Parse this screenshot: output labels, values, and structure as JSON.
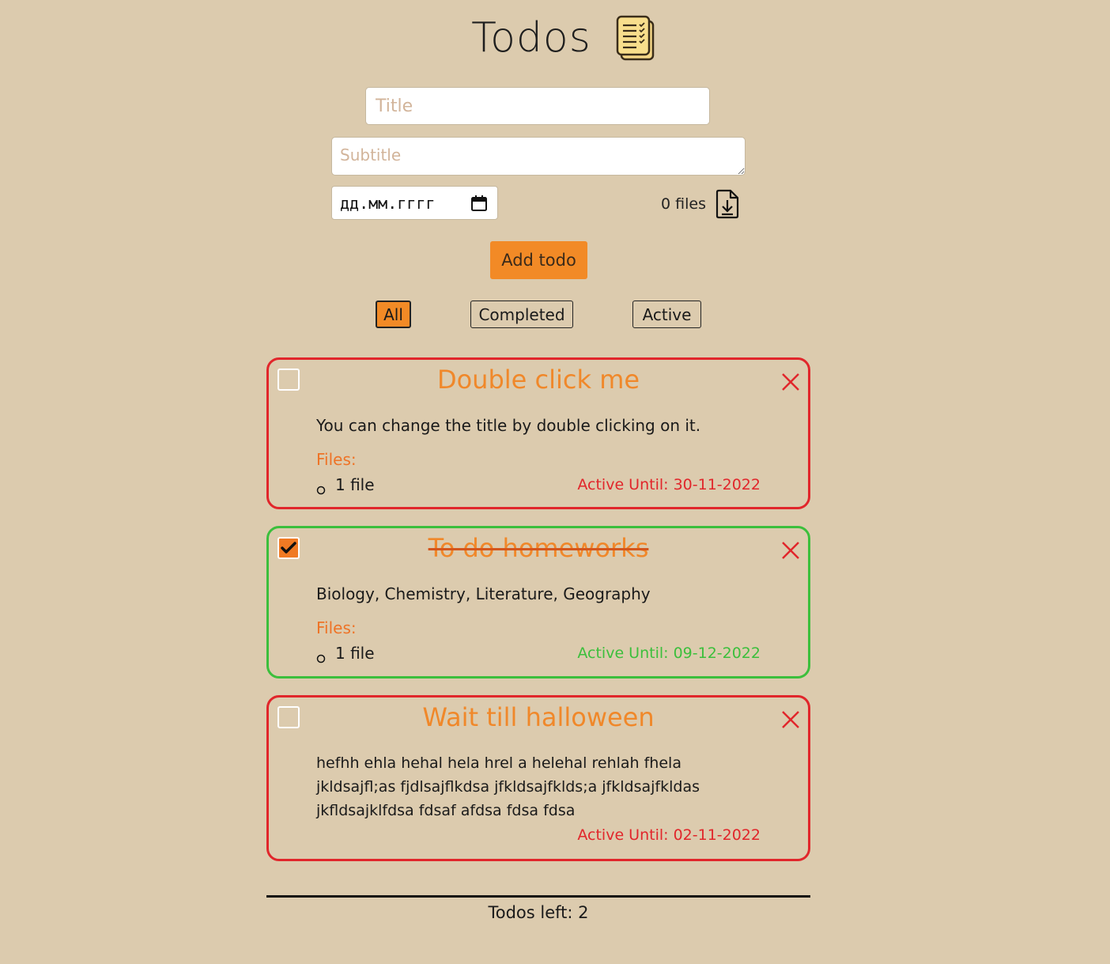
{
  "header": {
    "title": "Todos",
    "logo_icon": "notes-icon"
  },
  "form": {
    "title_placeholder": "Title",
    "subtitle_placeholder": "Subtitle",
    "date_placeholder": "дд.мм.гггг",
    "files_count_label": "0 files",
    "add_button_label": "Add todo"
  },
  "filters": {
    "all": "All",
    "completed": "Completed",
    "active": "Active",
    "selected": "All"
  },
  "todos": [
    {
      "title": "Double click me",
      "description": "You can change the title by double clicking on it.",
      "files_label": "Files:",
      "files": [
        "1 file"
      ],
      "active_until": "Active Until: 30-11-2022",
      "completed": false
    },
    {
      "title": "To do homeworks",
      "description": "Biology, Chemistry, Literature, Geography",
      "files_label": "Files:",
      "files": [
        "1 file"
      ],
      "active_until": "Active Until: 09-12-2022",
      "completed": true
    },
    {
      "title": "Wait till halloween",
      "description_lines": [
        "hefhh ehla hehal hela hrel a helehal rehlah fhela",
        "jkldsajfl;as fjdlsajflkdsa jfkldsajfklds;a jfkldsajfkldas",
        "jkfldsajklfdsa fdsaf afdsa fdsa fdsa"
      ],
      "active_until": "Active Until: 02-11-2022",
      "completed": false
    }
  ],
  "footer": {
    "todos_left_label": "Todos left:",
    "todos_left_count": "2"
  },
  "colors": {
    "background": "#dccbae",
    "accent": "#f28a26",
    "overdue": "#e1262b",
    "done": "#3cbf3c"
  }
}
